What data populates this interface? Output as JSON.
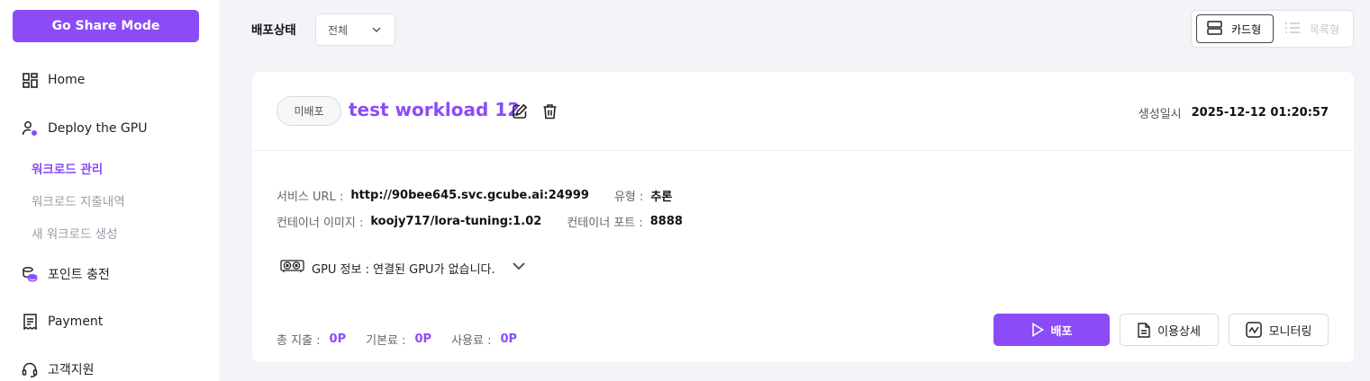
{
  "sidebar": {
    "share_button": "Go Share Mode",
    "nav": {
      "home": "Home",
      "deploy_gpu": "Deploy the GPU",
      "points": "포인트 충전",
      "payment": "Payment",
      "support": "고객지원"
    },
    "sub": {
      "workload_manage": "워크로드 관리",
      "workload_spend": "워크로드 지출내역",
      "new_workload": "새 워크로드 생성"
    }
  },
  "filter": {
    "label": "배포상태",
    "selected": "전체"
  },
  "view_toggle": {
    "card": "카드형",
    "list": "목록형"
  },
  "workload": {
    "status": "미배포",
    "title": "test workload 12",
    "created_label": "생성일시",
    "created_value": "2025-12-12 01:20:57",
    "service_url_label": "서비스 URL :",
    "service_url": "http://90bee645.svc.gcube.ai:24999",
    "type_label": "유형 :",
    "type_value": "추론",
    "image_label": "컨테이너 이미지 :",
    "image_value": "koojy717/lora-tuning:1.02",
    "port_label": "컨테이너 포트 :",
    "port_value": "8888",
    "gpu_info": "GPU 정보 : 연결된 GPU가 없습니다.",
    "total_label": "총 지출 :",
    "total_value": "0P",
    "base_label": "기본료 :",
    "base_value": "0P",
    "usage_label": "사용료 :",
    "usage_value": "0P",
    "deploy_button": "배포",
    "usage_detail_button": "이용상세",
    "monitoring_button": "모니터링"
  },
  "colors": {
    "accent": "#8b4cf7",
    "background": "#f3f4f8"
  },
  "icons": [
    "dashboard-icon",
    "user-gear-icon",
    "coins-icon",
    "receipt-icon",
    "headset-icon",
    "chevron-down-icon",
    "card-view-icon",
    "list-view-icon",
    "edit-icon",
    "trash-icon",
    "gpu-card-icon",
    "play-icon",
    "document-icon",
    "monitor-chart-icon"
  ]
}
